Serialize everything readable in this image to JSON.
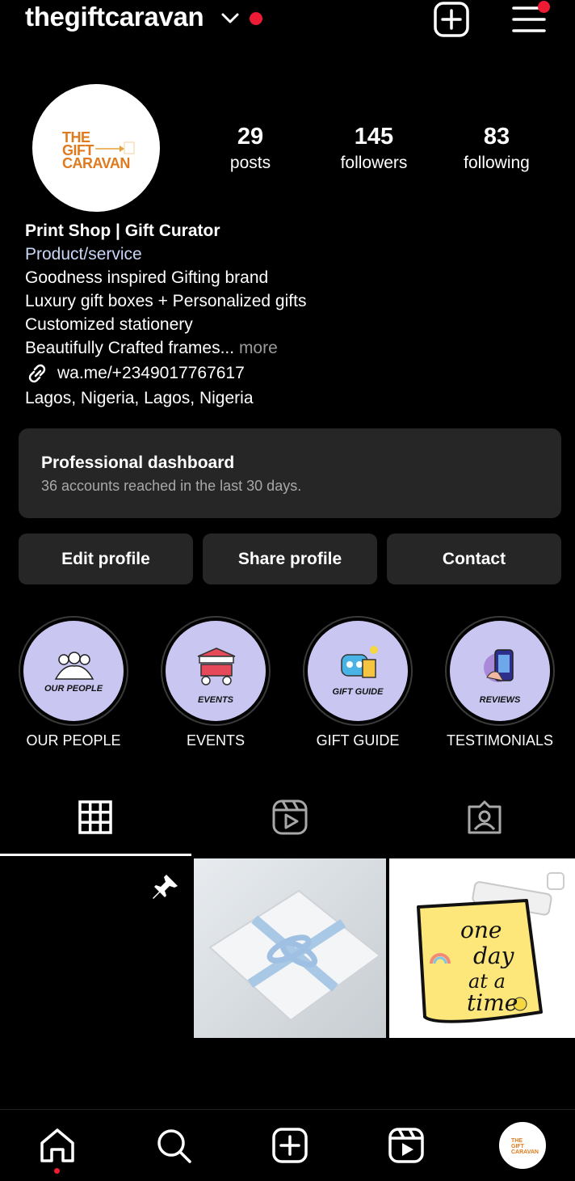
{
  "header": {
    "username": "thegiftcaravan",
    "notify_color": "#ed1b33"
  },
  "avatar": {
    "logo_line1": "THE",
    "logo_line2": "GIFT",
    "logo_line3": "CARAVAN"
  },
  "stats": [
    {
      "value": "29",
      "label": "posts"
    },
    {
      "value": "145",
      "label": "followers"
    },
    {
      "value": "83",
      "label": "following"
    }
  ],
  "bio": {
    "name": "Print Shop | Gift Curator",
    "category": "Product/service",
    "lines": [
      "Goodness inspired Gifting brand",
      "Luxury gift boxes + Personalized gifts",
      "Customized stationery",
      "Beautifully Crafted frames..."
    ],
    "more": " more",
    "link": "wa.me/+2349017767617",
    "location": "Lagos, Nigeria, Lagos, Nigeria"
  },
  "dashboard": {
    "title": "Professional dashboard",
    "subtitle": "36 accounts reached in the last 30 days."
  },
  "buttons": {
    "edit": "Edit profile",
    "share": "Share profile",
    "contact": "Contact"
  },
  "highlights": [
    {
      "caption": "OUR PEOPLE",
      "label": "OUR PEOPLE",
      "icon": "people-icon"
    },
    {
      "caption": "EVENTS",
      "label": "EVENTS",
      "icon": "cart-icon"
    },
    {
      "caption": "GIFT GUIDE",
      "label": "GIFT GUIDE",
      "icon": "robot-icon"
    },
    {
      "caption": "REVIEWS",
      "label": "TESTIMONIALS",
      "icon": "phone-icon"
    }
  ],
  "tabs": [
    "grid-icon",
    "reels-icon",
    "tagged-icon"
  ],
  "posts": [
    {
      "type": "pinned"
    },
    {
      "type": "gift-box"
    },
    {
      "note_words": [
        "one",
        "day",
        "at a",
        "time"
      ]
    }
  ],
  "nav": [
    "home-icon",
    "search-icon",
    "create-icon",
    "reels-icon",
    "profile-avatar"
  ]
}
